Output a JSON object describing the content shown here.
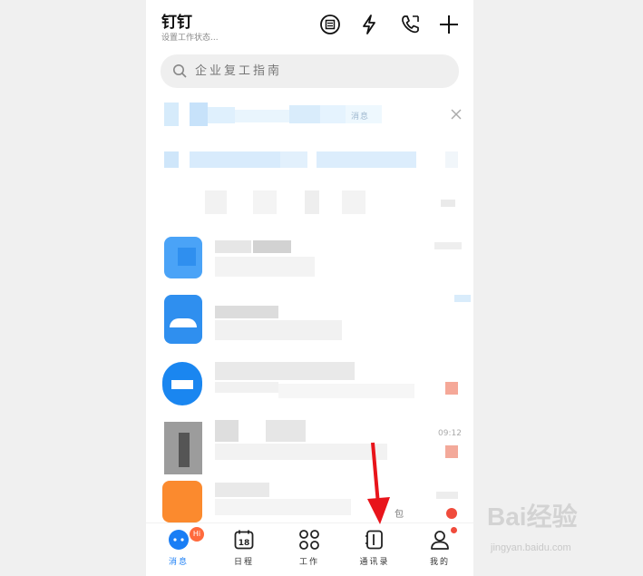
{
  "header": {
    "title": "钉钉",
    "status": "设置工作状态..."
  },
  "search": {
    "placeholder": "企业复工指南"
  },
  "banner": {
    "text_fragment": "消息"
  },
  "chat_list": {
    "times": [
      "09:12"
    ],
    "last_item_fragment": "包"
  },
  "tabbar": {
    "items": [
      {
        "label": "消息",
        "badge": "Hi",
        "active": true
      },
      {
        "label": "日程",
        "date": "18"
      },
      {
        "label": "工作"
      },
      {
        "label": "通讯录"
      },
      {
        "label": "我的",
        "dot": true
      }
    ]
  },
  "icons": [
    "ding-icon",
    "flash-icon",
    "phone-icon",
    "add-icon",
    "search-icon",
    "close-icon",
    "arrow-icon"
  ],
  "colors": {
    "accent": "#1a7ef5",
    "badge": "#ff6a3d",
    "annotation_arrow": "#e8141b"
  },
  "watermark": {
    "logo": "Bai经验",
    "url": "jingyan.baidu.com"
  }
}
